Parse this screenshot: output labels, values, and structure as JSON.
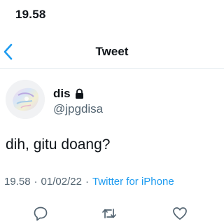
{
  "status_bar": {
    "time": "19.58"
  },
  "header": {
    "title": "Tweet",
    "back_icon": "chevron-left-icon"
  },
  "author": {
    "display_name": "dis",
    "handle": "@jpgdisa",
    "protected_icon": "lock-icon"
  },
  "tweet": {
    "text": "dih, gitu doang?",
    "time": "19.58",
    "separator": "·",
    "date": "01/02/22",
    "source": "Twitter for iPhone"
  },
  "actions": [
    "reply-icon",
    "retweet-icon",
    "like-icon"
  ],
  "colors": {
    "link": "#1d9bf0",
    "secondary_text": "#536471",
    "primary_text": "#0f1419"
  }
}
